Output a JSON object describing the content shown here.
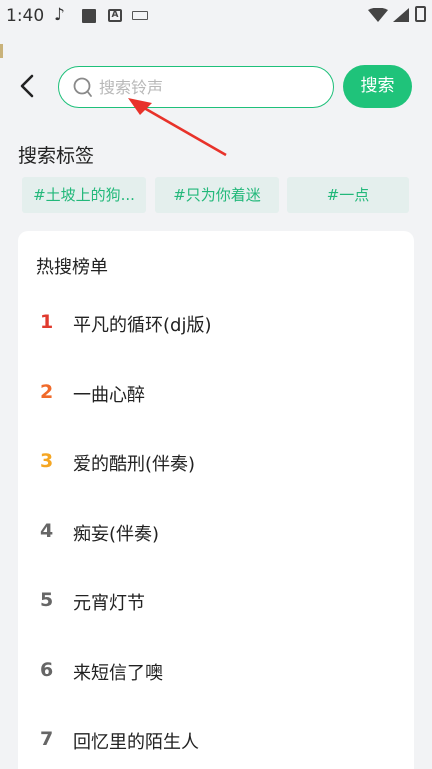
{
  "status_bar": {
    "time": "1:40",
    "icons": [
      "tiktok-icon",
      "square-notification-icon",
      "a-notification-icon",
      "keyboard-icon",
      "wifi-icon",
      "signal-icon",
      "battery-icon"
    ]
  },
  "search": {
    "placeholder": "搜索铃声",
    "value": "",
    "button_label": "搜索"
  },
  "tags": {
    "title": "搜索标签",
    "items": [
      "#土坡上的狗...",
      "#只为你着迷",
      "#一点"
    ]
  },
  "hot_list": {
    "title": "热搜榜单",
    "items": [
      {
        "rank": "1",
        "name": "平凡的循环(dj版)",
        "rank_color": "#e03a2e"
      },
      {
        "rank": "2",
        "name": "一曲心醉",
        "rank_color": "#f06a2a"
      },
      {
        "rank": "3",
        "name": "爱的酷刑(伴奏)",
        "rank_color": "#f5a623"
      },
      {
        "rank": "4",
        "name": "痴妄(伴奏)",
        "rank_color": "#666666"
      },
      {
        "rank": "5",
        "name": "元宵灯节",
        "rank_color": "#666666"
      },
      {
        "rank": "6",
        "name": "来短信了噢",
        "rank_color": "#666666"
      },
      {
        "rank": "7",
        "name": "回忆里的陌生人",
        "rank_color": "#666666"
      }
    ]
  },
  "colors": {
    "accent": "#1fc37a",
    "tag_bg": "#e4efed",
    "tag_text": "#22b87a",
    "annotation_arrow": "#e8322a"
  }
}
